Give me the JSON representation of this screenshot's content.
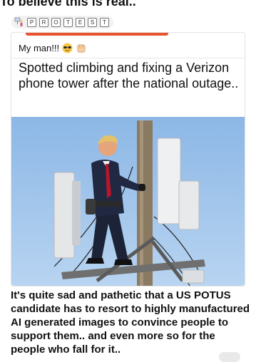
{
  "page_title": "To believe this is real..",
  "protest": {
    "icon": "protest-person-icon",
    "letters": [
      "P",
      "R",
      "O",
      "T",
      "E",
      "S",
      "T"
    ]
  },
  "post": {
    "header": "My man!!!",
    "header_icons": [
      "sunglasses-face-icon",
      "fist-bump-icon"
    ],
    "text": "Spotted climbing and fixing a Verizon phone tower after the national outage..",
    "image_icon": "man-on-utility-pole-photo"
  },
  "comment_lines": [
    "It's quite sad and pathetic that a US POTUS",
    "candidate has to resort to highly manufactured",
    "AI generated images to convince people to",
    "support them.. and even more so for the",
    "people who fall for it.."
  ],
  "colors": {
    "accent": "#e8542f",
    "sky": "#9fc4ea"
  }
}
